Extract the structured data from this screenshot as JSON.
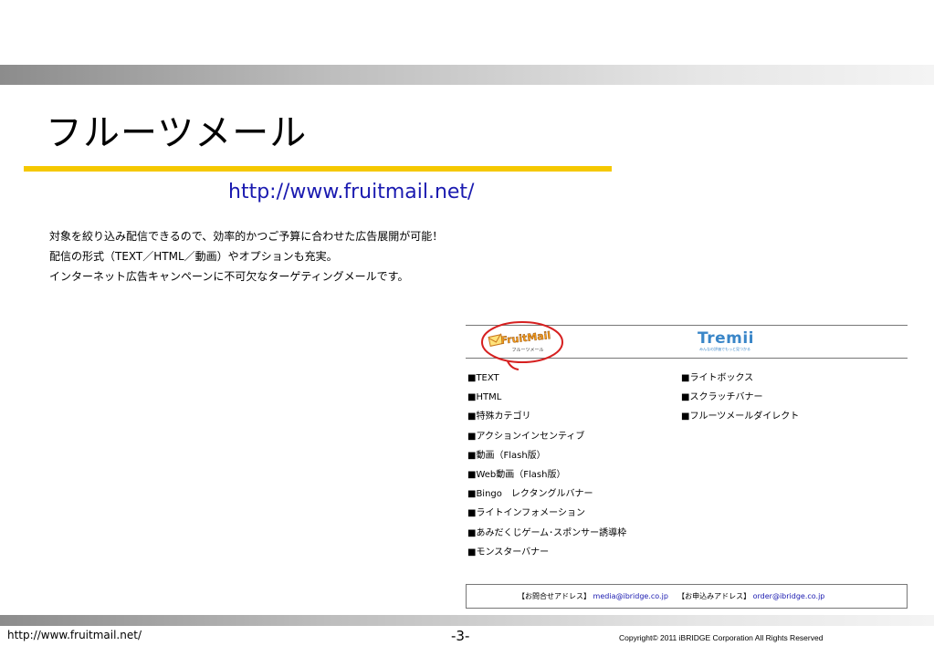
{
  "slide": {
    "title": "フルーツメール",
    "url": "http://www.fruitmail.net/",
    "intro_lines": [
      "対象を絞り込み配信できるので、効率的かつご予算に合わせた広告展開が可能！",
      "配信の形式（TEXT／HTML／動画）やオプションも充実。",
      "インターネット広告キャンペーンに不可欠なターゲティングメールです。"
    ]
  },
  "logos": {
    "fruitmail": {
      "wordmark": "FruitMail",
      "subtitle": "フルーツメール",
      "icon": "envelope-icon"
    },
    "tremii": {
      "wordmark": "Tremii",
      "subtitle": "みんなの評価でもっと見つかる"
    }
  },
  "formats": {
    "left": [
      "■TEXT",
      "■HTML",
      "■特殊カテゴリ",
      "■アクションインセンティブ",
      "■動画（Flash版）",
      "■Web動画（Flash版）",
      "■Bingo　レクタングルバナー",
      "■ライトインフォメーション",
      "■あみだくじゲーム･スポンサー誘導枠",
      "■モンスターバナー"
    ],
    "right": [
      "■ライトボックス",
      "■スクラッチバナー",
      "■フルーツメールダイレクト"
    ]
  },
  "contact": {
    "inquiry_label": "【お問合せアドレス】",
    "inquiry_email": "media@ibridge.co.jp",
    "order_label": "【お申込みアドレス】",
    "order_email": "order@ibridge.co.jp"
  },
  "footer": {
    "url": "http://www.fruitmail.net/",
    "page": "-3-",
    "copyright": "Copyright© 2011 iBRIDGE Corporation All Rights Reserved"
  },
  "colors": {
    "accent_rule": "#f5c800",
    "link": "#1a1ab0",
    "logo_ring": "#d62020",
    "tremii": "#3a86c8"
  }
}
